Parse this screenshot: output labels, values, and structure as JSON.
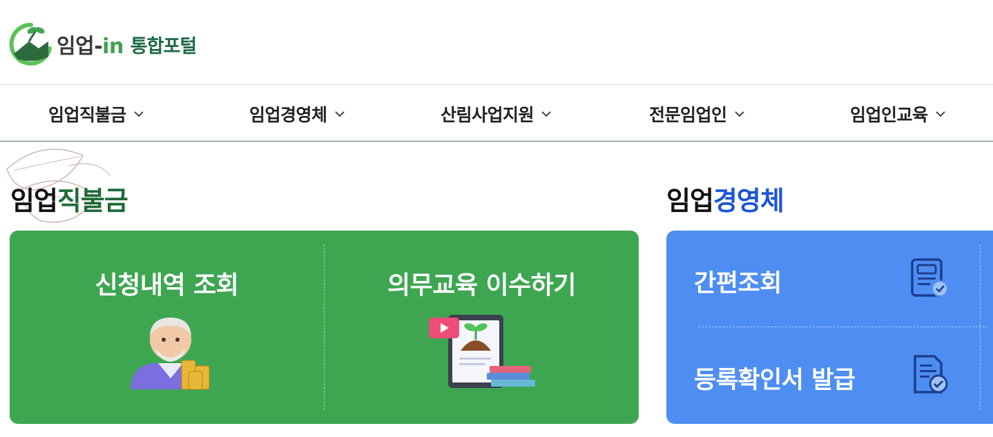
{
  "logo": {
    "main_prefix": "임업-",
    "main_accent": "in",
    "sub": "통합포털"
  },
  "nav": {
    "items": [
      {
        "label": "임업직불금"
      },
      {
        "label": "임업경영체"
      },
      {
        "label": "산림사업지원"
      },
      {
        "label": "전문임업인"
      },
      {
        "label": "임업인교육"
      }
    ]
  },
  "section_left": {
    "title_part1": "임업",
    "title_part2": "직불금",
    "items": [
      {
        "label": "신청내역 조회",
        "icon": "farmer-with-coins-icon"
      },
      {
        "label": "의무교육 이수하기",
        "icon": "tablet-sprout-books-icon"
      }
    ]
  },
  "section_right": {
    "title_part1": "임업",
    "title_part2": "경영체",
    "items": [
      {
        "label": "간편조회",
        "icon": "document-check-icon"
      },
      {
        "label": "등록확인서 발급",
        "icon": "certificate-check-icon"
      }
    ]
  },
  "colors": {
    "green_card": "#3ea651",
    "blue_card": "#4e8ef3",
    "green_title": "#1e6a35",
    "blue_title": "#1a55d6",
    "nav_border": "#3b7a58"
  }
}
